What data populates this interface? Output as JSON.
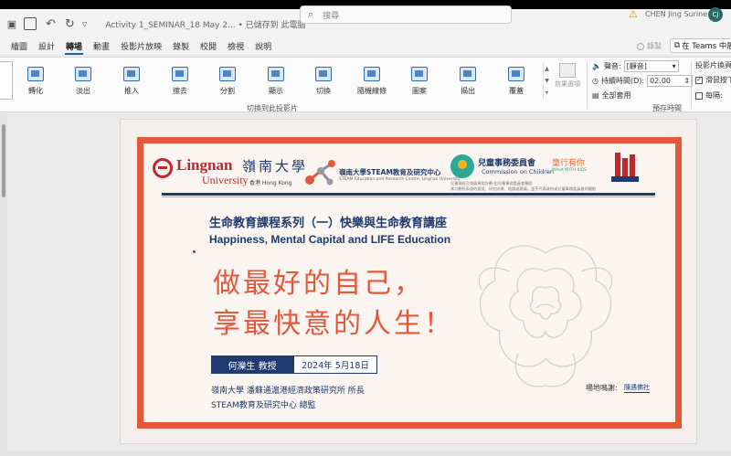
{
  "titlebar": {
    "doc_title": "Activity 1_SEMINAR_18 May 2...  •  已儲存到 此電腦",
    "search_placeholder": "搜尋",
    "user_name": "CHEN Jing Surine",
    "avatar_initials": "CJ"
  },
  "menu": {
    "tabs": [
      "繪圖",
      "設計",
      "轉場",
      "動畫",
      "投影片放映",
      "錄製",
      "校閱",
      "檢視",
      "說明"
    ],
    "active_tab": "轉場",
    "record_label": "錄製",
    "teams_label": "在 Teams 中展"
  },
  "ribbon": {
    "transitions": [
      "轉化",
      "淡出",
      "推入",
      "擦去",
      "分割",
      "顯示",
      "切換",
      "隨機線條",
      "圖案",
      "揭出",
      "覆蓋"
    ],
    "effect_options_label": "效果選項",
    "group_transitions_label": "切換到此投影片",
    "group_timing_label": "預存時間",
    "sound_label": "聲音:",
    "sound_value": "[靜音]",
    "duration_label": "持續時間(D):",
    "duration_value": "02.00",
    "apply_all_label": "全部套用",
    "advance_label": "投影片換頁",
    "on_click_label": "滑鼠按下",
    "after_label": "每隔:",
    "on_click_checked": true,
    "after_checked": false
  },
  "slide": {
    "lingnan_name_en": "Lingnan",
    "lingnan_name_zh": "嶺南大學",
    "lingnan_univ": "University",
    "lingnan_hk": "香港 Hong Kong",
    "steam_zh": "嶺南大學STEAM教育及研究中心",
    "steam_en": "STEAM Education and Research Centre, Lingnan University",
    "coc_zh": "兒童事務委員會",
    "coc_en": "Commission on Children",
    "walk_zh": "童行有你",
    "walk_en": "WALK WITH KIDS",
    "tiny_line1": "兒童福祉及發展資助計劃-由兒童事務委員會贊助",
    "tiny_line2": "本計劃所表達的意見、研究成果、結論或建議，並不代表政府或兒童事務委員會的觀點",
    "course_zh": "生命教育課程系列（一）快樂與生命教育講座",
    "course_en": "Happiness, Mental Capital and LIFE Education",
    "slogan_line1": "做最好的自己，",
    "slogan_line2": "享最快意的人生！",
    "speaker": "何濼生 教授",
    "date": "2024年 5月18日",
    "affiliation1": "嶺南大學 潘蘇通滬港經濟政策研究所 所長",
    "affiliation2": "STEAM教育及研究中心 總監",
    "venue_label": "場地鳴謝:",
    "venue_name": "隨遇佛社"
  },
  "colors": {
    "accent_red": "#e4583a",
    "navy": "#1e3a6e",
    "tan": "#c7a78c",
    "ribbon_blue": "#2e6bb2"
  }
}
